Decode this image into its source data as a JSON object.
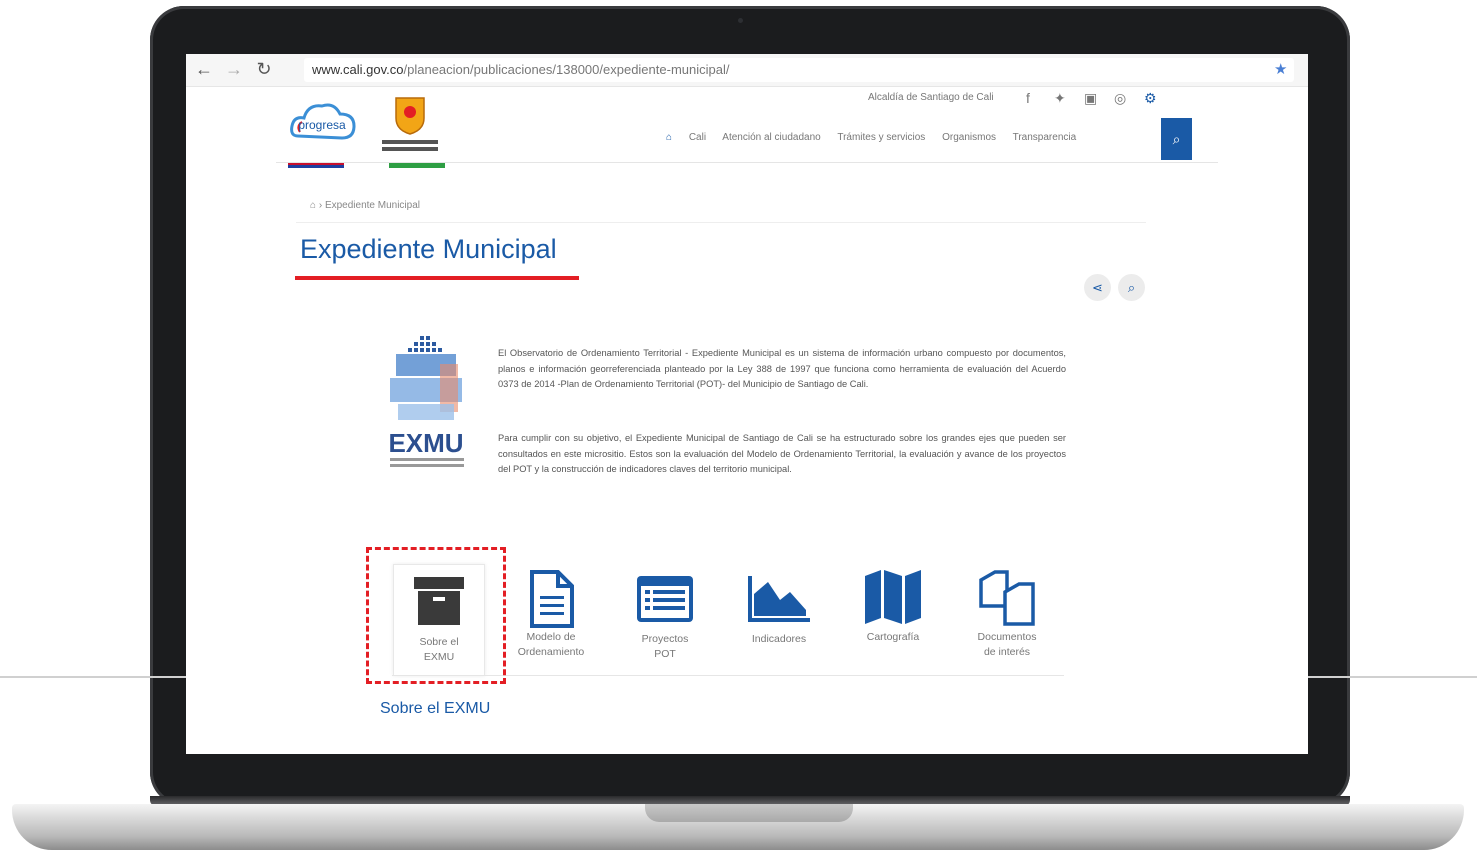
{
  "browser": {
    "url_domain": "www.cali.gov.co",
    "url_path": "/planeacion/publicaciones/138000/expediente-municipal/"
  },
  "header": {
    "top_link": "Alcaldía de Santiago de Cali",
    "logo_text": "progresa",
    "menu": [
      "Cali",
      "Atención al ciudadano",
      "Trámites y servicios",
      "Organismos",
      "Transparencia"
    ]
  },
  "breadcrumb": {
    "current": "Expediente Municipal"
  },
  "page": {
    "title": "Expediente Municipal",
    "logo_text": "EXMU",
    "paragraphs": [
      "El Observatorio de Ordenamiento Territorial - Expediente Municipal es un sistema de información urbano compuesto por documentos, planos e información georreferenciada planteado por la Ley 388 de 1997 que funciona como herramienta de evaluación del Acuerdo 0373 de 2014 -Plan de Ordenamiento Territorial (POT)- del Municipio de Santiago de Cali.",
      "Para cumplir con su objetivo, el Expediente Municipal de Santiago de Cali se ha estructurado sobre los grandes ejes que pueden ser consultados en este micrositio. Estos son la evaluación del Modelo de Ordenamiento Territorial, la evaluación y avance de los proyectos del POT y la construcción de indicadores claves del territorio municipal."
    ]
  },
  "tiles": [
    {
      "line1": "Sobre el",
      "line2": "EXMU"
    },
    {
      "line1": "Modelo de",
      "line2": "Ordenamiento"
    },
    {
      "line1": "Proyectos",
      "line2": "POT"
    },
    {
      "line1": "Indicadores",
      "line2": ""
    },
    {
      "line1": "Cartografía",
      "line2": ""
    },
    {
      "line1": "Documentos",
      "line2": "de interés"
    }
  ],
  "caption": "Sobre el EXMU",
  "colors": {
    "brand_blue": "#1a5aa6",
    "accent_red": "#e31e24",
    "icon_gray": "#3a3a3a"
  }
}
